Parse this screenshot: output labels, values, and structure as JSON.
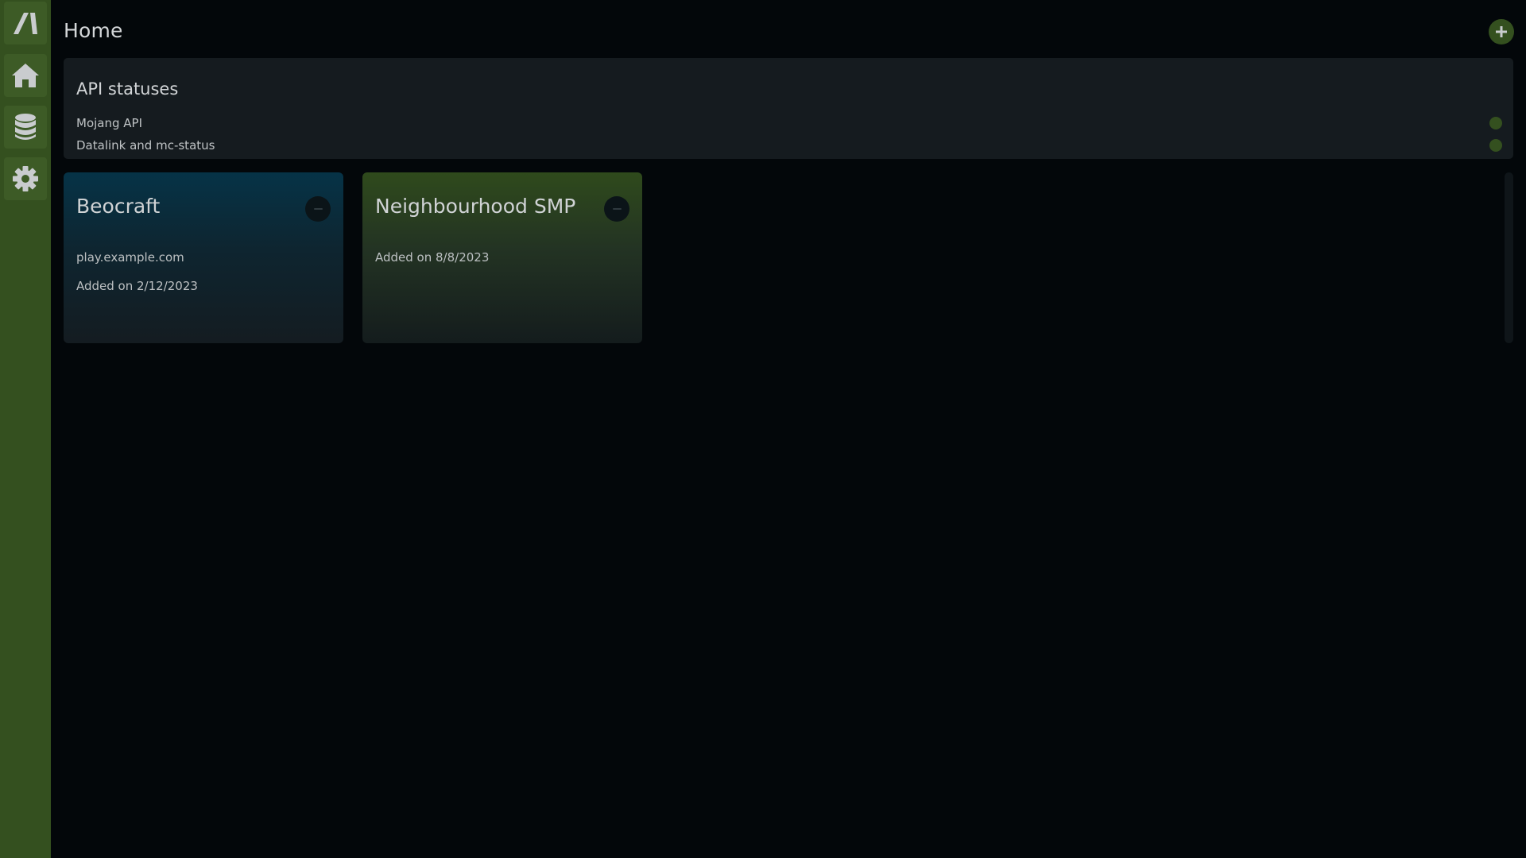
{
  "colors": {
    "sidebar": "#34501f",
    "background": "#03070a",
    "panel": "#151b1f",
    "status_ok": "#34501f",
    "card_blue": "#063347",
    "card_green": "#2f4a1c"
  },
  "sidebar": {
    "items": [
      {
        "icon": "app-logo-icon"
      },
      {
        "icon": "home-icon"
      },
      {
        "icon": "database-icon"
      },
      {
        "icon": "gear-icon"
      }
    ]
  },
  "header": {
    "title": "Home",
    "add_icon": "plus-icon"
  },
  "api_statuses": {
    "title": "API statuses",
    "items": [
      {
        "name": "Mojang API",
        "status": "ok"
      },
      {
        "name": "Datalink and mc-status",
        "status": "ok"
      }
    ]
  },
  "servers": [
    {
      "name": "Beocraft",
      "address": "play.example.com",
      "added": "Added on 2/12/2023",
      "remove_icon": "minus-icon"
    },
    {
      "name": "Neighbourhood SMP",
      "address": "",
      "added": "Added on 8/8/2023",
      "remove_icon": "minus-icon"
    }
  ]
}
